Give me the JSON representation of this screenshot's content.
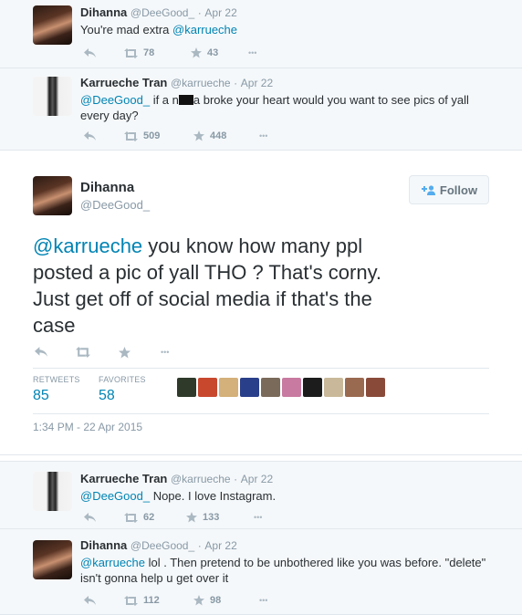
{
  "tweets": [
    {
      "fullname": "Dihanna",
      "username": "@DeeGood_",
      "time": "Apr 22",
      "text_plain": "You're mad extra ",
      "text_mention": "@karrueche",
      "retweets": "78",
      "favorites": "43"
    },
    {
      "fullname": "Karrueche Tran",
      "username": "@karrueche",
      "time": "Apr 22",
      "text_mention": "@DeeGood_",
      "text_part1": " if a n",
      "text_part2": "a broke your heart would you want to see pics of yall",
      "text_line2": "every day?",
      "retweets": "509",
      "favorites": "448"
    },
    {
      "fullname": "Karrueche Tran",
      "username": "@karrueche",
      "time": "Apr 22",
      "text_mention": "@DeeGood_",
      "text_plain": " Nope. I love Instagram.",
      "retweets": "62",
      "favorites": "133"
    },
    {
      "fullname": "Dihanna",
      "username": "@DeeGood_",
      "time": "Apr 22",
      "text_mention": "@karrueche",
      "text_plain": " lol . Then pretend to be unbothered like you was before. \"delete\"",
      "text_line2": "isn't gonna help u get over it",
      "retweets": "112",
      "favorites": "98"
    }
  ],
  "main_tweet": {
    "fullname": "Dihanna",
    "username": "@DeeGood_",
    "follow_label": "Follow",
    "text_mention": "@karrueche",
    "text_line1": " you know how many ppl",
    "text_line2": "posted a pic of yall THO ? That's corny.",
    "text_line3": "Just get off of social media if that's the",
    "text_line4": "case",
    "retweets_label": "RETWEETS",
    "retweets": "85",
    "favorites_label": "FAVORITES",
    "favorites": "58",
    "timestamp": "1:34 PM - 22 Apr 2015"
  },
  "dot": "·",
  "more": "•••",
  "colors": {
    "link": "#0084b4",
    "muted": "#8899a6",
    "icon": "#aab8c2",
    "conversation_bg": "#f5f8fa"
  },
  "icons": [
    "reply-icon",
    "retweet-icon",
    "favorite-icon",
    "more-icon",
    "follow-person-icon"
  ]
}
